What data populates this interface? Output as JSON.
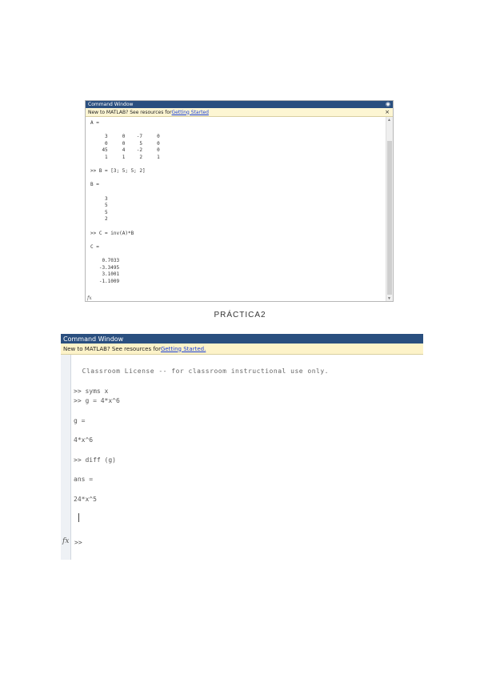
{
  "window1": {
    "title": "Command Window",
    "notice_text": "New to MATLAB? See resources for ",
    "notice_link": "Getting Started",
    "close_glyph": "×",
    "lines": [
      {
        "text": "A =",
        "row": 0
      },
      {
        "text": "     3     0    -7     0",
        "row": 2
      },
      {
        "text": "     0     0     5     0",
        "row": 3
      },
      {
        "text": "    45     4    -2     0",
        "row": 4
      },
      {
        "text": "     1     1     2     1",
        "row": 5
      },
      {
        "text": ">> B = [3; 5; 5; 2]",
        "row": 7
      },
      {
        "text": "B =",
        "row": 9
      },
      {
        "text": "     3",
        "row": 11
      },
      {
        "text": "     5",
        "row": 12
      },
      {
        "text": "     5",
        "row": 13
      },
      {
        "text": "     2",
        "row": 14
      },
      {
        "text": ">> C = inv(A)*B",
        "row": 16
      },
      {
        "text": "C =",
        "row": 18
      },
      {
        "text": "    0.7033",
        "row": 20
      },
      {
        "text": "   -3.3495",
        "row": 21
      },
      {
        "text": "    3.1001",
        "row": 22
      },
      {
        "text": "   -1.1009",
        "row": 23
      }
    ],
    "fx": "fx"
  },
  "caption": "PRÁCTICA2",
  "window2": {
    "title": "Command Window",
    "notice_text": "New to MATLAB? See resources for ",
    "notice_link": "Getting Started.",
    "lines": [
      {
        "text": "  Classroom License -- for classroom instructional use only.",
        "row": 0,
        "kind": "banner"
      },
      {
        "text": ">> syms x",
        "row": 2
      },
      {
        "text": ">> g = 4*x^6",
        "row": 3
      },
      {
        "text": "g =",
        "row": 5
      },
      {
        "text": "4*x^6",
        "row": 7
      },
      {
        "text": ">> diff (g)",
        "row": 9
      },
      {
        "text": "ans =",
        "row": 11
      },
      {
        "text": "24*x^5",
        "row": 13
      }
    ],
    "prompt": ">>",
    "fx": "fx"
  }
}
